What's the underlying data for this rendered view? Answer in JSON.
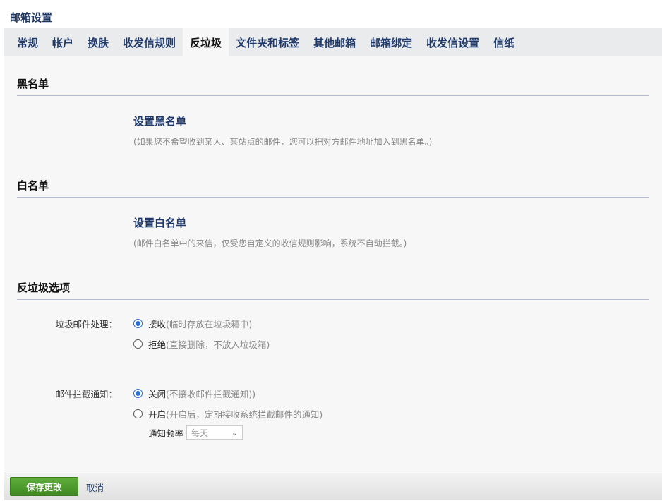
{
  "page": {
    "title": "邮箱设置"
  },
  "tabs": [
    {
      "label": "常规"
    },
    {
      "label": "帐户"
    },
    {
      "label": "换肤"
    },
    {
      "label": "收发信规则"
    },
    {
      "label": "反垃圾",
      "active": true
    },
    {
      "label": "文件夹和标签"
    },
    {
      "label": "其他邮箱"
    },
    {
      "label": "邮箱绑定"
    },
    {
      "label": "收发信设置"
    },
    {
      "label": "信纸"
    }
  ],
  "blacklist": {
    "heading": "黑名单",
    "link": "设置黑名单",
    "desc": "(如果您不希望收到某人、某站点的邮件，您可以把对方邮件地址加入到黑名单。)"
  },
  "whitelist": {
    "heading": "白名单",
    "link": "设置白名单",
    "desc": "(邮件白名单中的来信，仅受您自定义的收信规则影响，系统不自动拦截。)"
  },
  "antispam": {
    "heading": "反垃圾选项",
    "spam_handling": {
      "label": "垃圾邮件处理：",
      "options": [
        {
          "text": "接收",
          "hint": "(临时存放在垃圾箱中)",
          "checked": true
        },
        {
          "text": "拒绝",
          "hint": "(直接删除，不放入垃圾箱)",
          "checked": false
        }
      ]
    },
    "block_notice": {
      "label": "邮件拦截通知：",
      "options": [
        {
          "text": "关闭",
          "hint": "(不接收邮件拦截通知))",
          "checked": true
        },
        {
          "text": "开启",
          "hint": "(开启后，定期接收系统拦截邮件的通知)",
          "checked": false
        }
      ],
      "frequency_label": "通知频率",
      "frequency_value": "每天"
    }
  },
  "footer": {
    "save_label": "保存更改",
    "cancel_label": "取消"
  },
  "colors": {
    "accent": "#1f3a6a",
    "save_button": "#4c9a2a",
    "radio_checked": "#2c6fd1"
  }
}
